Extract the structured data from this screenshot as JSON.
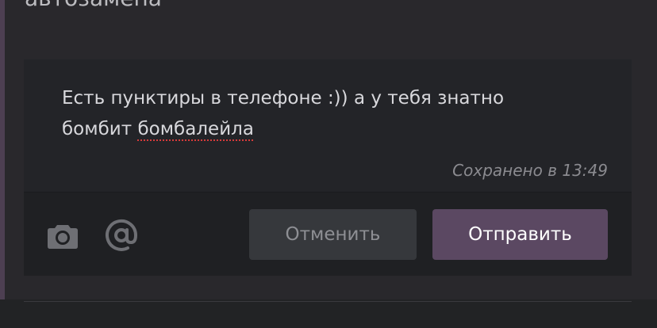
{
  "post": {
    "text_line2": "автозамена"
  },
  "composer": {
    "message_line1": "Есть пунктиры в телефоне :)) а у тебя знатно",
    "message_line2_prefix": "бомбит ",
    "message_line2_misspelled": "бомбалейла",
    "saved_note": "Сохранено в 13:49"
  },
  "toolbar": {
    "camera_icon": "camera-icon",
    "mention_icon": "at-icon",
    "cancel_label": "Отменить",
    "send_label": "Отправить"
  },
  "colors": {
    "background": "#29282c",
    "composer_bg": "#232428",
    "toolbar_bg": "#1f2023",
    "send_button": "#5b4862",
    "cancel_button": "#36383c",
    "accent_bar": "#4d3f52"
  }
}
